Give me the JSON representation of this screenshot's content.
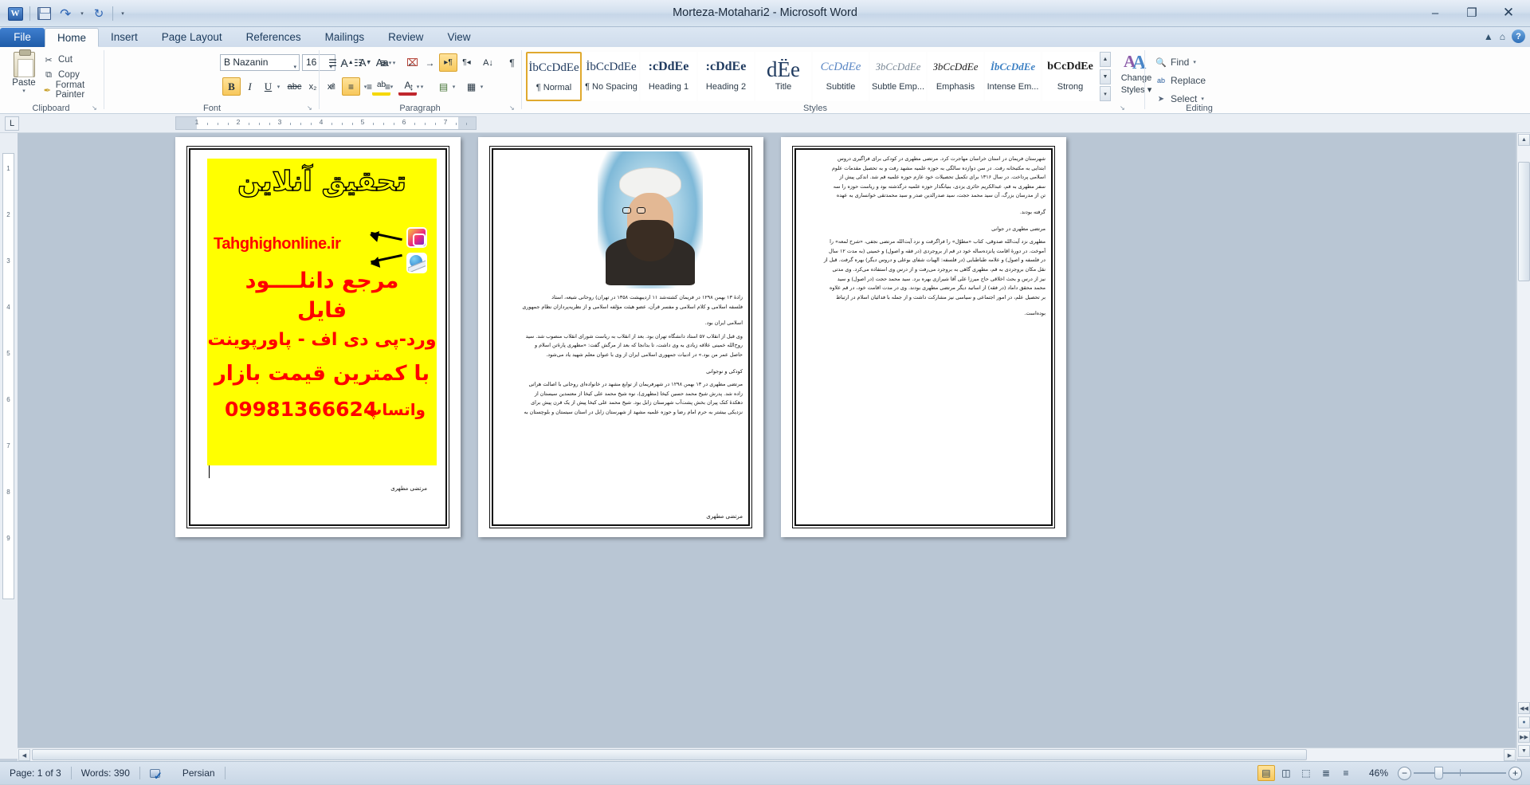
{
  "window": {
    "title": "Morteza-Motahari2  -  Microsoft Word",
    "minimize": "–",
    "restore": "❐",
    "close": "✕"
  },
  "quick_access": {
    "word_logo": "W",
    "save": "save-icon",
    "undo": "↶",
    "redo": "↻",
    "customize": "▾"
  },
  "help_icons": {
    "minimize_ribbon": "▲",
    "restore_ribbon": "⌂",
    "help": "?"
  },
  "tabs": [
    {
      "label": "File",
      "active": false,
      "file": true
    },
    {
      "label": "Home",
      "active": true
    },
    {
      "label": "Insert",
      "active": false
    },
    {
      "label": "Page Layout",
      "active": false
    },
    {
      "label": "References",
      "active": false
    },
    {
      "label": "Mailings",
      "active": false
    },
    {
      "label": "Review",
      "active": false
    },
    {
      "label": "View",
      "active": false
    }
  ],
  "clipboard": {
    "group_label": "Clipboard",
    "paste_label": "Paste",
    "paste_caret": "▾",
    "cut_label": "Cut",
    "cut_icon": "✂",
    "copy_label": "Copy",
    "copy_icon": "⧉",
    "format_painter_label": "Format Painter",
    "format_painter_icon": "✒",
    "dialog_launcher": "↘"
  },
  "font": {
    "group_label": "Font",
    "name": "B Nazanin",
    "size": "16",
    "caret": "▾",
    "grow_font": "A",
    "shrink_font": "A",
    "change_case": "Aa",
    "clear_formatting": "⌧",
    "bold": "B",
    "italic": "I",
    "underline": "U",
    "strikethrough": "abc",
    "subscript": "x₂",
    "superscript": "x²",
    "text_effects": "A",
    "highlight": "ab",
    "font_color": "A",
    "dialog_launcher": "↘"
  },
  "paragraph": {
    "group_label": "Paragraph",
    "bullets": "☰",
    "numbering": "☷",
    "multilevel": "≣",
    "decrease_indent": "←",
    "increase_indent": "→",
    "rtl_direction": "▸¶",
    "ltr_direction": "¶◂",
    "sort": "A↓",
    "show_marks": "¶",
    "align_left": "≡",
    "align_center": "≡",
    "align_right": "≡",
    "justify": "≡",
    "line_spacing": "↕",
    "shading": "▤",
    "borders": "▦",
    "dialog_launcher": "↘"
  },
  "styles": {
    "group_label": "Styles",
    "items": [
      {
        "preview": "İbCcDdEe",
        "name": "¶ Normal",
        "selected": true
      },
      {
        "preview": "İbCcDdEe",
        "name": "¶ No Spacing",
        "selected": false
      },
      {
        "preview": ":cDdEe",
        "name": "Heading 1",
        "selected": false
      },
      {
        "preview": ":cDdEe",
        "name": "Heading 2",
        "selected": false
      },
      {
        "preview": "dЁe",
        "name": "Title",
        "selected": false
      },
      {
        "preview": "CcDdEe",
        "name": "Subtitle",
        "selected": false
      },
      {
        "preview": "ЗbCcDdEe",
        "name": "Subtle Emp...",
        "selected": false
      },
      {
        "preview": "ЗbCcDdEe",
        "name": "Emphasis",
        "selected": false
      },
      {
        "preview": "İbCcDdEe",
        "name": "Intense Em...",
        "selected": false
      },
      {
        "preview": "bCcDdEe",
        "name": "Strong",
        "selected": false
      }
    ],
    "scroll_up": "▲",
    "scroll_down": "▼",
    "more": "▾",
    "change_styles_label_line1": "Change",
    "change_styles_label_line2": "Styles",
    "change_styles_caret": "▾",
    "dialog_launcher": "↘"
  },
  "editing": {
    "group_label": "Editing",
    "find_label": "Find",
    "find_icon": "🔍",
    "find_caret": "▾",
    "replace_label": "Replace",
    "replace_icon": "ab",
    "select_label": "Select",
    "select_icon": "➤",
    "select_caret": "▾"
  },
  "ruler": {
    "tab_selector": "L",
    "h_numbers": [
      "1",
      "2",
      "3",
      "4",
      "5",
      "6",
      "7"
    ],
    "v_numbers": [
      "1",
      "2",
      "3",
      "4",
      "5",
      "6",
      "7",
      "8",
      "9"
    ]
  },
  "document": {
    "page1": {
      "ad": {
        "headline": "تحقیق آنلاین",
        "url": "Tahghighonline.ir",
        "line_download": "مرجع دانلــــود",
        "line_file": "فایل",
        "line_formats": "ورد-پی دی اف - پاورپوینت",
        "line_price": "با کمترین قیمت بازار",
        "whatsapp_label": "واتساپ",
        "phone": "09981366624",
        "instagram_icon": "instagram-icon",
        "globe_icon": "globe-icon"
      },
      "signature": "مرتضی مطهری"
    },
    "page2": {
      "portrait_alt": "portrait-morteza-motahari",
      "paragraphs": [
        "زادهٔ ۱۳ بهمن ۱۲۹۸ در فریمان    کشته‌شد ۱۱ اردیبهشت ۱۳۵۸ در تهران) روحانی شیعه، استاد",
        "فلسفه اسلامی و کلام اسلامی و مفسر قرآن، عضو هیئت مؤلفه اسلامی و از نظریه‌پردازان نظام جمهوری",
        "اسلامی ایران بود.",
        "وی قبل از انقلاب ۵۷ استاد دانشگاه تهران بود. بعد از انقلاب به ریاست شورای انقلاب منصوب شد. سید",
        "روح‌الله خمینی علاقه زیادی به وی داشت، تا بدانجا که بعد از مرگش گفت: «مطهری پارهٔ‌تن اسلام و",
        "حاصل عمر من بود.» در ادبیات جمهوری اسلامی ایران از وی با عنوان معلم شهید یاد می‌شود.",
        "کودکی و نوجوانی",
        "مرتضی مطهری در ۱۳ بهمن ۱۲۹۸ در شهرفریمان از توابع مشهد در خانواده‌ای روحانی با اصالت هراتی",
        "زاده شد. پدرش شیخ محمد حسین کیخا (مطهری)، نوه شیخ محمد علی کیخا از معتمدین سیستان از",
        "دهکدهٔ کتک پیران بخش پشت‌آب شهرستان زابل بود. شیخ محمد علی کیخا پیش از یک قرن پیش برای",
        "نزدیکی بیشتر به حرم امام رضا و حوزه علمیه مشهد از شهرستان زابل در استان سیستان و بلوچستان به"
      ]
    },
    "page3": {
      "paragraphs": [
        "شهرستان فریمان در استان خراسان مهاجرت کرد. مرتضی مطهری در کودکی برای فراگیری دروس",
        "ابتدایی به مکتبخانه رفت. در سن دوازده سالگی به حوزه علمیه مشهد رفت و به تحصیل مقدمات علوم",
        "اسلامی پرداخت. در سال ۱۳۱۶ برای تکمیل تحصیلات خود عازم حوزه علمیه قم شد. اندکی پیش از",
        "سفر مطهری به قم، عبدالکریم حائری یزدی، بنیانگذار حوزه علمیه درگذشته بود و ریاست حوزه را سه",
        "تن از مدرسان بزرگ، آن سید محمد حجت، سید صدرالدین صدر و سید محمدتقی خوانساری به عهده",
        "گرفته بودند.",
        "مرتضی مطهری در جوانی",
        "مطهری نزد آیت‌الله صدوقی، کتاب «مطوّل» را فراگرفت و نزد آیت‌الله مرتضی نجفی، «شرح لمعه» را",
        "آموخت. در دورهٔ اقامت پانزده‌ساله خود در قم از بروجردی (در فقه و اصول) و خمینی (به مدت ۱۲ سال",
        "در فلسفه و اصول) و علامه طباطبایی (در فلسفه: الهیات شفای بوعلی و دروس دیگر) بهره گرفت. قبل از",
        "نقل مکان بروجردی به قم، مطهری گاهی به بروجرد می‌رفت و از درس وی استفاده می‌کرد. وی مدتی",
        "نیز از درس و بحث اخلاقی حاج میرزا علی آقا شیرازی بهره برد. سید محمد حجت (در اصول) و سید",
        "محمد محقق داماد (در فقه) از اساتید دیگر مرتضی مطهری بودند. وی در مدت اقامت خود، در قم علاوه",
        "بر تحصیل علم، در امور اجتماعی و سیاسی نیز مشارکت داشت و از جمله با فدائیان اسلام در ارتباط",
        "بوده‌است."
      ]
    }
  },
  "status_bar": {
    "page": "Page: 1 of 3",
    "words": "Words: 390",
    "language": "Persian",
    "spell_icon": "spell-check-icon",
    "views": [
      {
        "name": "print-layout",
        "glyph": "▤",
        "active": true
      },
      {
        "name": "full-screen-reading",
        "glyph": "◫",
        "active": false
      },
      {
        "name": "web-layout",
        "glyph": "⬚",
        "active": false
      },
      {
        "name": "outline",
        "glyph": "≣",
        "active": false
      },
      {
        "name": "draft",
        "glyph": "≡",
        "active": false
      }
    ],
    "zoom_level": "46%",
    "zoom_out": "−",
    "zoom_in": "+"
  },
  "scroll": {
    "up": "▲",
    "down": "▼",
    "left": "◀",
    "right": "▶",
    "prev_page": "◀◀",
    "next_page": "▶▶",
    "select_object": "●"
  }
}
